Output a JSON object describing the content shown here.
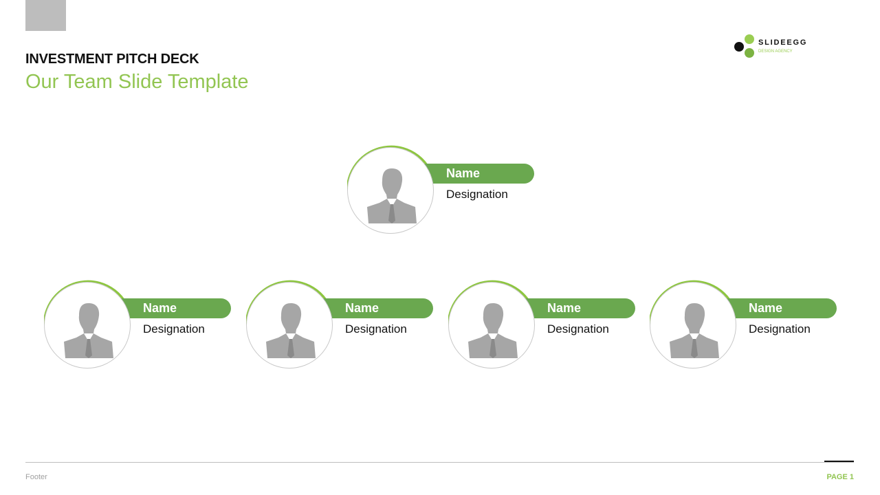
{
  "header": {
    "deck_title": "INVESTMENT PITCH DECK",
    "slide_title": "Our Team Slide Template"
  },
  "logo": {
    "brand": "SLIDEEGG",
    "tagline": "DESIGN AGENCY"
  },
  "team": {
    "leader": {
      "name": "Name",
      "designation": "Designation",
      "icon": "person-silhouette-icon"
    },
    "members": [
      {
        "name": "Name",
        "designation": "Designation",
        "icon": "person-silhouette-icon"
      },
      {
        "name": "Name",
        "designation": "Designation",
        "icon": "person-silhouette-icon"
      },
      {
        "name": "Name",
        "designation": "Designation",
        "icon": "person-silhouette-icon"
      },
      {
        "name": "Name",
        "designation": "Designation",
        "icon": "person-silhouette-icon"
      }
    ]
  },
  "colors": {
    "accent_green": "#6aa84f",
    "title_green": "#92c552",
    "avatar_gray": "#a6a6a6"
  },
  "footer": {
    "text": "Footer",
    "page": "PAGE 1"
  }
}
